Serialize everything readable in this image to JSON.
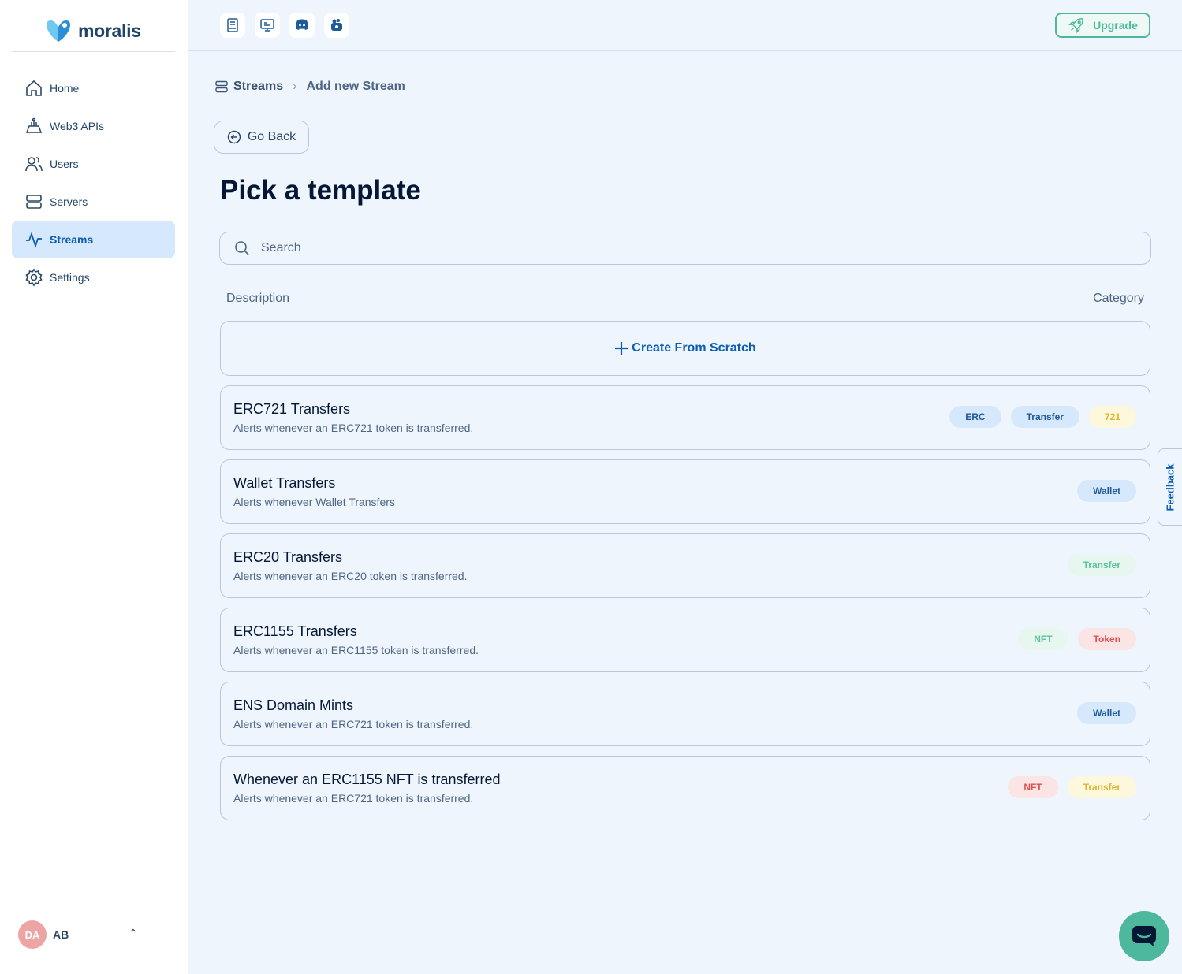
{
  "brand": {
    "name": "moralis"
  },
  "sidebar": {
    "items": [
      {
        "label": "Home",
        "icon": "home-icon"
      },
      {
        "label": "Web3 APIs",
        "icon": "web3-apis-icon"
      },
      {
        "label": "Users",
        "icon": "users-icon"
      },
      {
        "label": "Servers",
        "icon": "servers-icon"
      },
      {
        "label": "Streams",
        "icon": "streams-icon",
        "active": true
      },
      {
        "label": "Settings",
        "icon": "gear-icon"
      }
    ]
  },
  "user": {
    "initials": "DA",
    "name": "AB",
    "chevron": "⌃"
  },
  "topbar": {
    "icons": [
      "docs-icon",
      "tutorials-icon",
      "discord-icon",
      "community-icon"
    ],
    "upgrade_label": "Upgrade"
  },
  "breadcrumb": {
    "root": "Streams",
    "current": "Add new Stream"
  },
  "go_back_label": "Go Back",
  "page_title": "Pick a template",
  "search": {
    "placeholder": "Search"
  },
  "columns": {
    "description": "Description",
    "category": "Category"
  },
  "create_label": "Create From Scratch",
  "templates": [
    {
      "title": "ERC721 Transfers",
      "desc": "Alerts whenever an ERC721 token is transferred.",
      "tags": [
        {
          "label": "ERC",
          "color": "blue"
        },
        {
          "label": "Transfer",
          "color": "blue"
        },
        {
          "label": "721",
          "color": "yellow"
        }
      ]
    },
    {
      "title": "Wallet Transfers",
      "desc": "Alerts whenever Wallet Transfers",
      "tags": [
        {
          "label": "Wallet",
          "color": "blue"
        }
      ]
    },
    {
      "title": "ERC20 Transfers",
      "desc": "Alerts whenever an ERC20 token is transferred.",
      "tags": [
        {
          "label": "Transfer",
          "color": "green"
        }
      ]
    },
    {
      "title": "ERC1155 Transfers",
      "desc": "Alerts whenever an ERC1155 token is transferred.",
      "tags": [
        {
          "label": "NFT",
          "color": "green"
        },
        {
          "label": "Token",
          "color": "red"
        }
      ]
    },
    {
      "title": "ENS Domain Mints",
      "desc": "Alerts whenever an ERC721 token is transferred.",
      "tags": [
        {
          "label": "Wallet",
          "color": "blue"
        }
      ]
    },
    {
      "title": "Whenever an ERC1155 NFT is transferred",
      "desc": "Alerts whenever an ERC721 token is transferred.",
      "tags": [
        {
          "label": "NFT",
          "color": "red"
        },
        {
          "label": "Transfer",
          "color": "yellow"
        }
      ]
    }
  ],
  "feedback_label": "Feedback",
  "colors": {
    "accent": "#0a5eb5",
    "brand_green": "#4db89b",
    "background": "#eef5fd"
  }
}
